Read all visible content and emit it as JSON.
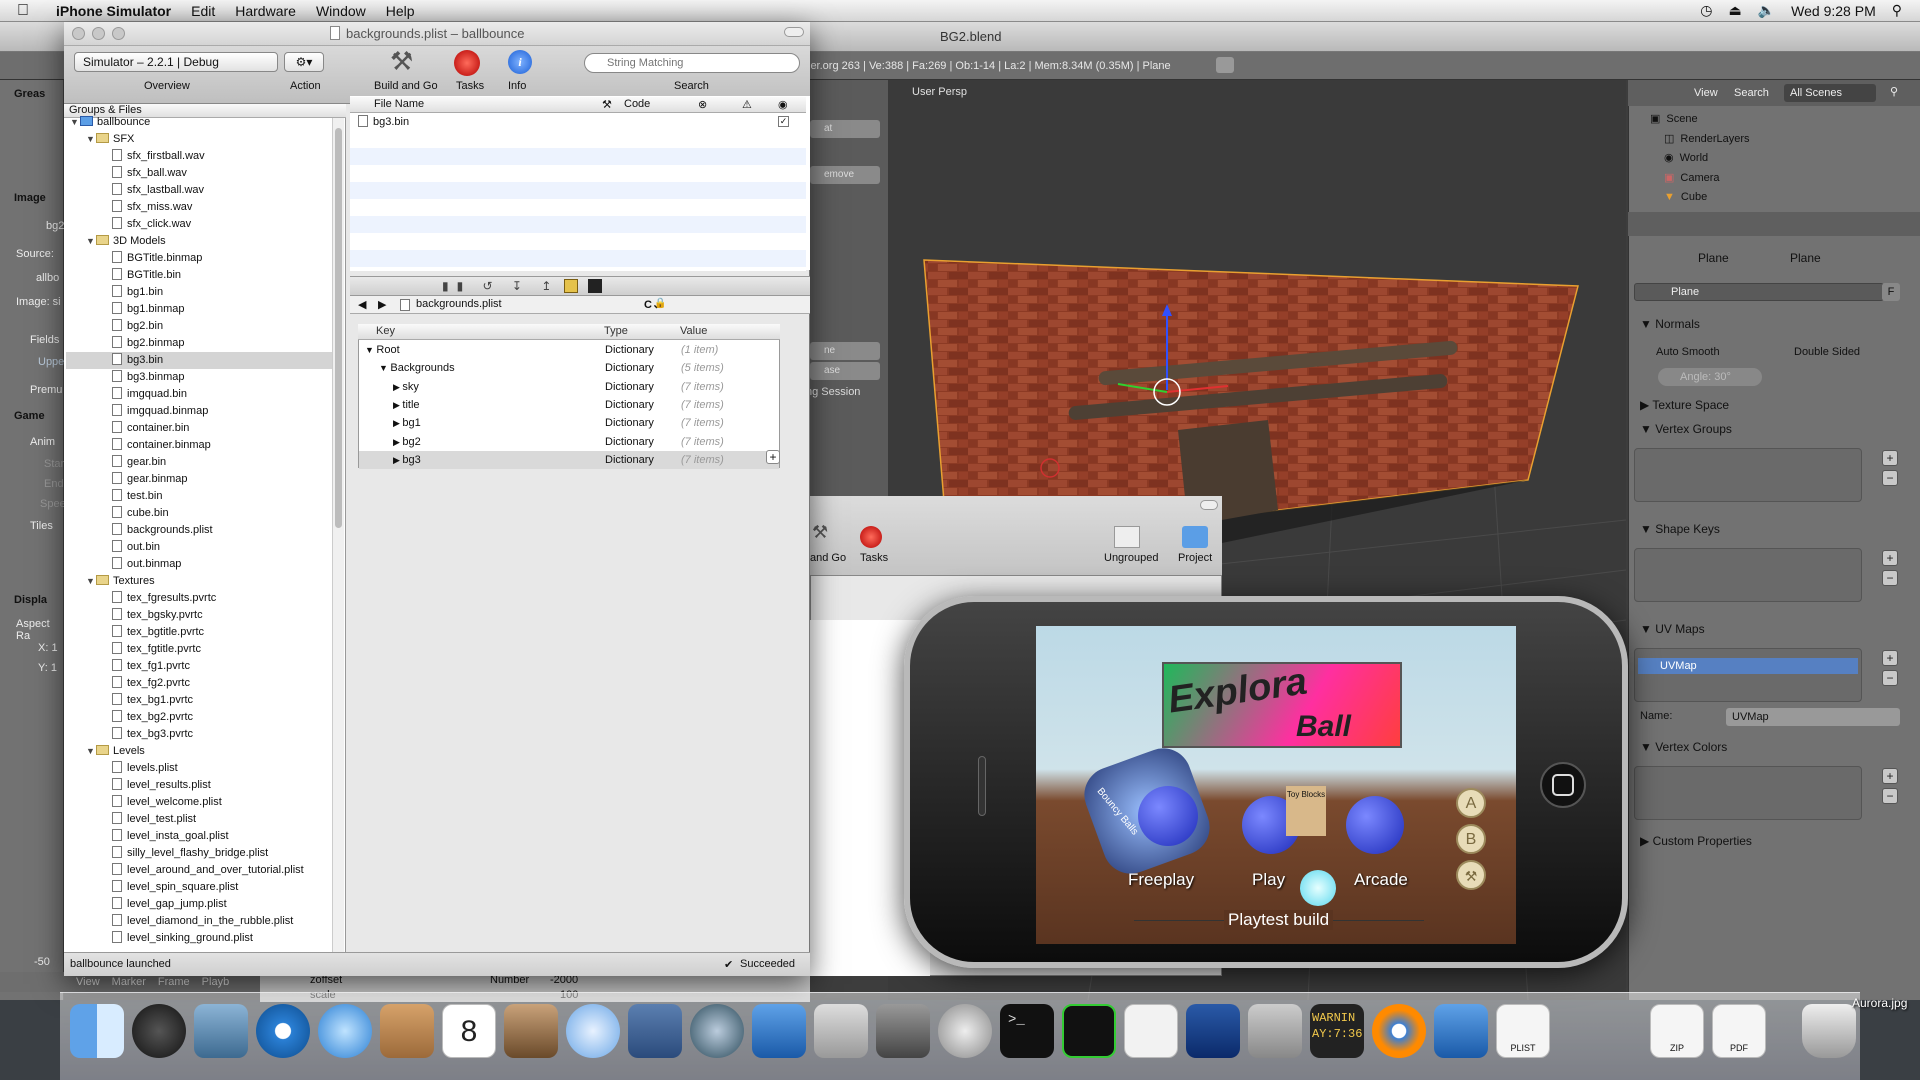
{
  "menubar": {
    "app_name": "iPhone Simulator",
    "items": [
      "Edit",
      "Hardware",
      "Window",
      "Help"
    ],
    "clock": "Wed 9:28 PM"
  },
  "blender": {
    "title": "BG2.blend",
    "header_info": "ler.org 263 | Ve:388 | Fa:269 | Ob:1-14 | La:2 | Mem:8.34M (0.35M) | Plane",
    "viewport_label": "User Persp",
    "left_labels": [
      "Greas",
      "Image",
      "bg2",
      "Source:",
      "allbo",
      "Image: si",
      "Fields",
      "Uppe",
      "Premu",
      "Game",
      "Anim",
      "Star",
      "End",
      "Spee",
      "Tiles",
      "Displa",
      "Aspect Ra",
      "X: 1",
      "Y: 1",
      "-50"
    ],
    "mid_buttons": [
      "at",
      "emove",
      "ne",
      "ase",
      "ng Session"
    ],
    "outliner": {
      "view": "View",
      "search": "Search",
      "scenes": "All Scenes",
      "rows": [
        "Scene",
        "RenderLayers",
        "World",
        "Camera",
        "Cube"
      ]
    },
    "properties": {
      "breadcrumb": [
        "Plane",
        "Plane"
      ],
      "object_name": "Plane",
      "f_label": "F",
      "normals": "Normals",
      "auto_smooth": "Auto Smooth",
      "double_sided": "Double Sided",
      "angle": "Angle: 30°",
      "texture_space": "Texture Space",
      "vertex_groups": "Vertex Groups",
      "shape_keys": "Shape Keys",
      "uv_maps": "UV Maps",
      "uv_map_item": "UVMap",
      "name_label": "Name:",
      "name_value": "UVMap",
      "vertex_colors": "Vertex Colors",
      "custom_props": "Custom Properties"
    },
    "bottom_menu": [
      "View",
      "Marker",
      "Frame",
      "Playb"
    ]
  },
  "xcode": {
    "title": "backgrounds.plist – ballbounce",
    "sdk": "Simulator – 2.2.1 | Debug",
    "toolbar": {
      "overview": "Overview",
      "action": "Action",
      "build_go": "Build and Go",
      "tasks": "Tasks",
      "info": "Info",
      "search_placeholder": "String Matching",
      "search_label": "Search"
    },
    "groups_header": "Groups & Files",
    "tree": [
      {
        "label": "ballbounce",
        "level": 0,
        "type": "project"
      },
      {
        "label": "SFX",
        "level": 1,
        "type": "folder"
      },
      {
        "label": "sfx_firstball.wav",
        "level": 2,
        "type": "file"
      },
      {
        "label": "sfx_ball.wav",
        "level": 2,
        "type": "file"
      },
      {
        "label": "sfx_lastball.wav",
        "level": 2,
        "type": "file"
      },
      {
        "label": "sfx_miss.wav",
        "level": 2,
        "type": "file"
      },
      {
        "label": "sfx_click.wav",
        "level": 2,
        "type": "file"
      },
      {
        "label": "3D Models",
        "level": 1,
        "type": "folder"
      },
      {
        "label": "BGTitle.binmap",
        "level": 2,
        "type": "file"
      },
      {
        "label": "BGTitle.bin",
        "level": 2,
        "type": "file"
      },
      {
        "label": "bg1.bin",
        "level": 2,
        "type": "file"
      },
      {
        "label": "bg1.binmap",
        "level": 2,
        "type": "file"
      },
      {
        "label": "bg2.bin",
        "level": 2,
        "type": "file"
      },
      {
        "label": "bg2.binmap",
        "level": 2,
        "type": "file"
      },
      {
        "label": "bg3.bin",
        "level": 2,
        "type": "file",
        "selected": true
      },
      {
        "label": "bg3.binmap",
        "level": 2,
        "type": "file"
      },
      {
        "label": "imgquad.bin",
        "level": 2,
        "type": "file"
      },
      {
        "label": "imgquad.binmap",
        "level": 2,
        "type": "file"
      },
      {
        "label": "container.bin",
        "level": 2,
        "type": "file"
      },
      {
        "label": "container.binmap",
        "level": 2,
        "type": "file"
      },
      {
        "label": "gear.bin",
        "level": 2,
        "type": "file"
      },
      {
        "label": "gear.binmap",
        "level": 2,
        "type": "file"
      },
      {
        "label": "test.bin",
        "level": 2,
        "type": "file"
      },
      {
        "label": "cube.bin",
        "level": 2,
        "type": "file"
      },
      {
        "label": "backgrounds.plist",
        "level": 2,
        "type": "file"
      },
      {
        "label": "out.bin",
        "level": 2,
        "type": "file"
      },
      {
        "label": "out.binmap",
        "level": 2,
        "type": "file"
      },
      {
        "label": "Textures",
        "level": 1,
        "type": "folder"
      },
      {
        "label": "tex_fgresults.pvrtc",
        "level": 2,
        "type": "file"
      },
      {
        "label": "tex_bgsky.pvrtc",
        "level": 2,
        "type": "file"
      },
      {
        "label": "tex_bgtitle.pvrtc",
        "level": 2,
        "type": "file"
      },
      {
        "label": "tex_fgtitle.pvrtc",
        "level": 2,
        "type": "file"
      },
      {
        "label": "tex_fg1.pvrtc",
        "level": 2,
        "type": "file"
      },
      {
        "label": "tex_fg2.pvrtc",
        "level": 2,
        "type": "file"
      },
      {
        "label": "tex_bg1.pvrtc",
        "level": 2,
        "type": "file"
      },
      {
        "label": "tex_bg2.pvrtc",
        "level": 2,
        "type": "file"
      },
      {
        "label": "tex_bg3.pvrtc",
        "level": 2,
        "type": "file"
      },
      {
        "label": "Levels",
        "level": 1,
        "type": "folder"
      },
      {
        "label": "levels.plist",
        "level": 2,
        "type": "file"
      },
      {
        "label": "level_results.plist",
        "level": 2,
        "type": "file"
      },
      {
        "label": "level_welcome.plist",
        "level": 2,
        "type": "file"
      },
      {
        "label": "level_test.plist",
        "level": 2,
        "type": "file"
      },
      {
        "label": "level_insta_goal.plist",
        "level": 2,
        "type": "file"
      },
      {
        "label": "silly_level_flashy_bridge.plist",
        "level": 2,
        "type": "file"
      },
      {
        "label": "level_around_and_over_tutorial.plist",
        "level": 2,
        "type": "file"
      },
      {
        "label": "level_spin_square.plist",
        "level": 2,
        "type": "file"
      },
      {
        "label": "level_gap_jump.plist",
        "level": 2,
        "type": "file"
      },
      {
        "label": "level_diamond_in_the_rubble.plist",
        "level": 2,
        "type": "file"
      },
      {
        "label": "level_sinking_ground.plist",
        "level": 2,
        "type": "file"
      }
    ],
    "detail_columns": [
      "File Name",
      "Code"
    ],
    "detail_files": [
      "bg3.bin"
    ],
    "editor_file": "backgrounds.plist",
    "plist_columns": [
      "Key",
      "Type",
      "Value"
    ],
    "plist_rows": [
      {
        "key": "Root",
        "type": "Dictionary",
        "value": "(1 item)",
        "level": 0
      },
      {
        "key": "Backgrounds",
        "type": "Dictionary",
        "value": "(5 items)",
        "level": 1
      },
      {
        "key": "sky",
        "type": "Dictionary",
        "value": "(7 items)",
        "level": 2
      },
      {
        "key": "title",
        "type": "Dictionary",
        "value": "(7 items)",
        "level": 2
      },
      {
        "key": "bg1",
        "type": "Dictionary",
        "value": "(7 items)",
        "level": 2
      },
      {
        "key": "bg2",
        "type": "Dictionary",
        "value": "(7 items)",
        "level": 2
      },
      {
        "key": "bg3",
        "type": "Dictionary",
        "value": "(7 items)",
        "level": 2,
        "selected": true
      }
    ],
    "status_left": "ballbounce launched",
    "status_right": "Succeeded"
  },
  "xcode2": {
    "build_go": "and Go",
    "tasks": "Tasks",
    "ungrouped": "Ungrouped",
    "project": "Project"
  },
  "game": {
    "title_line1": "Explora",
    "title_line2": "Ball",
    "menu": [
      "Freeplay",
      "Play",
      "Arcade"
    ],
    "buttons": [
      "A",
      "B"
    ],
    "footer": "Playtest build",
    "bouncy": "Bouncy Balls",
    "toy": "Toy Blocks"
  },
  "dock_labels": {
    "warn": "WARNIN",
    "warn_time": "AY:7:36",
    "zip": "ZIP",
    "pdf": "PDF",
    "plist": "PLIST",
    "aurora": "Aurora.jpg",
    "number": "Number",
    "zoffset": "zoffset",
    "scale": "scale",
    "num_value": "-2000",
    "num_value2": "100"
  }
}
